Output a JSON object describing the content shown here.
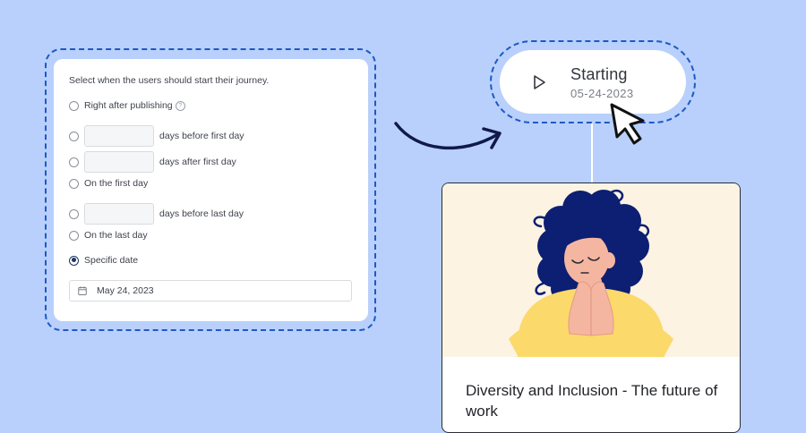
{
  "form": {
    "title": "Select when the users should start their journey.",
    "options": [
      {
        "label": "Right after publishing",
        "has_input": false,
        "checked": false,
        "has_help": true
      },
      {
        "label": "days before first day",
        "has_input": true,
        "checked": false
      },
      {
        "label": "days after first day",
        "has_input": true,
        "checked": false
      },
      {
        "label": "On the first day",
        "has_input": false,
        "checked": false
      },
      {
        "label": "days before last day",
        "has_input": true,
        "checked": false
      },
      {
        "label": "On the last day",
        "has_input": false,
        "checked": false
      },
      {
        "label": "Specific date",
        "has_input": false,
        "checked": true
      }
    ],
    "help_glyph": "?",
    "date_value": "May 24, 2023",
    "date_icon": "calendar-icon"
  },
  "start": {
    "title": "Starting",
    "date": "05-24-2023",
    "icon": "play-icon"
  },
  "course": {
    "title": "Diversity and Inclusion - The future of work"
  },
  "colors": {
    "background": "#b8d0fb",
    "dashed_frame": "#1e59c4",
    "radio_checked": "#1c3560",
    "arrow": "#101a4a",
    "illustration_bg": "#fcf3e3",
    "hair": "#0d1f72",
    "sweater": "#fbd96b"
  }
}
